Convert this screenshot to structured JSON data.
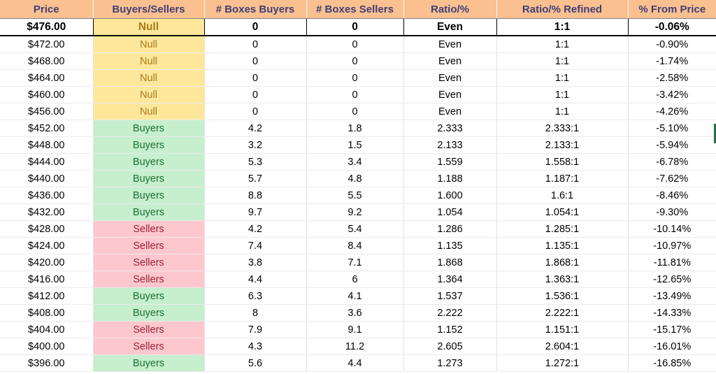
{
  "table": {
    "name": "price-level-buyers-sellers-table",
    "columns": [
      {
        "key": "price",
        "label": "Price"
      },
      {
        "key": "buyers_sellers",
        "label": "Buyers/Sellers"
      },
      {
        "key": "boxes_buyers",
        "label": "# Boxes Buyers"
      },
      {
        "key": "boxes_sellers",
        "label": "# Boxes Sellers"
      },
      {
        "key": "ratio_pct",
        "label": "Ratio/%"
      },
      {
        "key": "ratio_pct_refined",
        "label": "Ratio/% Refined"
      },
      {
        "key": "pct_from_price",
        "label": "% From Price"
      }
    ],
    "rows": [
      {
        "price": "$476.00",
        "buyers_sellers": "Null",
        "category": "null",
        "boxes_buyers": "0",
        "boxes_sellers": "0",
        "ratio_pct": "Even",
        "ratio_pct_refined": "1:1",
        "pct_from_price": "-0.06%",
        "highlighted": true
      },
      {
        "price": "$472.00",
        "buyers_sellers": "Null",
        "category": "null",
        "boxes_buyers": "0",
        "boxes_sellers": "0",
        "ratio_pct": "Even",
        "ratio_pct_refined": "1:1",
        "pct_from_price": "-0.90%",
        "highlighted": false
      },
      {
        "price": "$468.00",
        "buyers_sellers": "Null",
        "category": "null",
        "boxes_buyers": "0",
        "boxes_sellers": "0",
        "ratio_pct": "Even",
        "ratio_pct_refined": "1:1",
        "pct_from_price": "-1.74%",
        "highlighted": false
      },
      {
        "price": "$464.00",
        "buyers_sellers": "Null",
        "category": "null",
        "boxes_buyers": "0",
        "boxes_sellers": "0",
        "ratio_pct": "Even",
        "ratio_pct_refined": "1:1",
        "pct_from_price": "-2.58%",
        "highlighted": false
      },
      {
        "price": "$460.00",
        "buyers_sellers": "Null",
        "category": "null",
        "boxes_buyers": "0",
        "boxes_sellers": "0",
        "ratio_pct": "Even",
        "ratio_pct_refined": "1:1",
        "pct_from_price": "-3.42%",
        "highlighted": false
      },
      {
        "price": "$456.00",
        "buyers_sellers": "Null",
        "category": "null",
        "boxes_buyers": "0",
        "boxes_sellers": "0",
        "ratio_pct": "Even",
        "ratio_pct_refined": "1:1",
        "pct_from_price": "-4.26%",
        "highlighted": false
      },
      {
        "price": "$452.00",
        "buyers_sellers": "Buyers",
        "category": "buyers",
        "boxes_buyers": "4.2",
        "boxes_sellers": "1.8",
        "ratio_pct": "2.333",
        "ratio_pct_refined": "2.333:1",
        "pct_from_price": "-5.10%",
        "highlighted": false
      },
      {
        "price": "$448.00",
        "buyers_sellers": "Buyers",
        "category": "buyers",
        "boxes_buyers": "3.2",
        "boxes_sellers": "1.5",
        "ratio_pct": "2.133",
        "ratio_pct_refined": "2.133:1",
        "pct_from_price": "-5.94%",
        "highlighted": false
      },
      {
        "price": "$444.00",
        "buyers_sellers": "Buyers",
        "category": "buyers",
        "boxes_buyers": "5.3",
        "boxes_sellers": "3.4",
        "ratio_pct": "1.559",
        "ratio_pct_refined": "1.558:1",
        "pct_from_price": "-6.78%",
        "highlighted": false
      },
      {
        "price": "$440.00",
        "buyers_sellers": "Buyers",
        "category": "buyers",
        "boxes_buyers": "5.7",
        "boxes_sellers": "4.8",
        "ratio_pct": "1.188",
        "ratio_pct_refined": "1.187:1",
        "pct_from_price": "-7.62%",
        "highlighted": false
      },
      {
        "price": "$436.00",
        "buyers_sellers": "Buyers",
        "category": "buyers",
        "boxes_buyers": "8.8",
        "boxes_sellers": "5.5",
        "ratio_pct": "1.600",
        "ratio_pct_refined": "1.6:1",
        "pct_from_price": "-8.46%",
        "highlighted": false
      },
      {
        "price": "$432.00",
        "buyers_sellers": "Buyers",
        "category": "buyers",
        "boxes_buyers": "9.7",
        "boxes_sellers": "9.2",
        "ratio_pct": "1.054",
        "ratio_pct_refined": "1.054:1",
        "pct_from_price": "-9.30%",
        "highlighted": false
      },
      {
        "price": "$428.00",
        "buyers_sellers": "Sellers",
        "category": "sellers",
        "boxes_buyers": "4.2",
        "boxes_sellers": "5.4",
        "ratio_pct": "1.286",
        "ratio_pct_refined": "1.285:1",
        "pct_from_price": "-10.14%",
        "highlighted": false
      },
      {
        "price": "$424.00",
        "buyers_sellers": "Sellers",
        "category": "sellers",
        "boxes_buyers": "7.4",
        "boxes_sellers": "8.4",
        "ratio_pct": "1.135",
        "ratio_pct_refined": "1.135:1",
        "pct_from_price": "-10.97%",
        "highlighted": false
      },
      {
        "price": "$420.00",
        "buyers_sellers": "Sellers",
        "category": "sellers",
        "boxes_buyers": "3.8",
        "boxes_sellers": "7.1",
        "ratio_pct": "1.868",
        "ratio_pct_refined": "1.868:1",
        "pct_from_price": "-11.81%",
        "highlighted": false
      },
      {
        "price": "$416.00",
        "buyers_sellers": "Sellers",
        "category": "sellers",
        "boxes_buyers": "4.4",
        "boxes_sellers": "6",
        "ratio_pct": "1.364",
        "ratio_pct_refined": "1.363:1",
        "pct_from_price": "-12.65%",
        "highlighted": false
      },
      {
        "price": "$412.00",
        "buyers_sellers": "Buyers",
        "category": "buyers",
        "boxes_buyers": "6.3",
        "boxes_sellers": "4.1",
        "ratio_pct": "1.537",
        "ratio_pct_refined": "1.536:1",
        "pct_from_price": "-13.49%",
        "highlighted": false
      },
      {
        "price": "$408.00",
        "buyers_sellers": "Buyers",
        "category": "buyers",
        "boxes_buyers": "8",
        "boxes_sellers": "3.6",
        "ratio_pct": "2.222",
        "ratio_pct_refined": "2.222:1",
        "pct_from_price": "-14.33%",
        "highlighted": false
      },
      {
        "price": "$404.00",
        "buyers_sellers": "Sellers",
        "category": "sellers",
        "boxes_buyers": "7.9",
        "boxes_sellers": "9.1",
        "ratio_pct": "1.152",
        "ratio_pct_refined": "1.151:1",
        "pct_from_price": "-15.17%",
        "highlighted": false
      },
      {
        "price": "$400.00",
        "buyers_sellers": "Sellers",
        "category": "sellers",
        "boxes_buyers": "4.3",
        "boxes_sellers": "11.2",
        "ratio_pct": "2.605",
        "ratio_pct_refined": "2.604:1",
        "pct_from_price": "-16.01%",
        "highlighted": false
      },
      {
        "price": "$396.00",
        "buyers_sellers": "Buyers",
        "category": "buyers",
        "boxes_buyers": "5.6",
        "boxes_sellers": "4.4",
        "ratio_pct": "1.273",
        "ratio_pct_refined": "1.272:1",
        "pct_from_price": "-16.85%",
        "highlighted": false
      }
    ]
  },
  "colors": {
    "header_fill": "#fac090",
    "header_text": "#3f3f76",
    "null_fill": "#fde79a",
    "null_text": "#a97a1c",
    "buyers_fill": "#c6efcd",
    "buyers_text": "#1d6f32",
    "sellers_fill": "#fec7ce",
    "sellers_text": "#9c2235",
    "selection_marker": "#217346"
  }
}
